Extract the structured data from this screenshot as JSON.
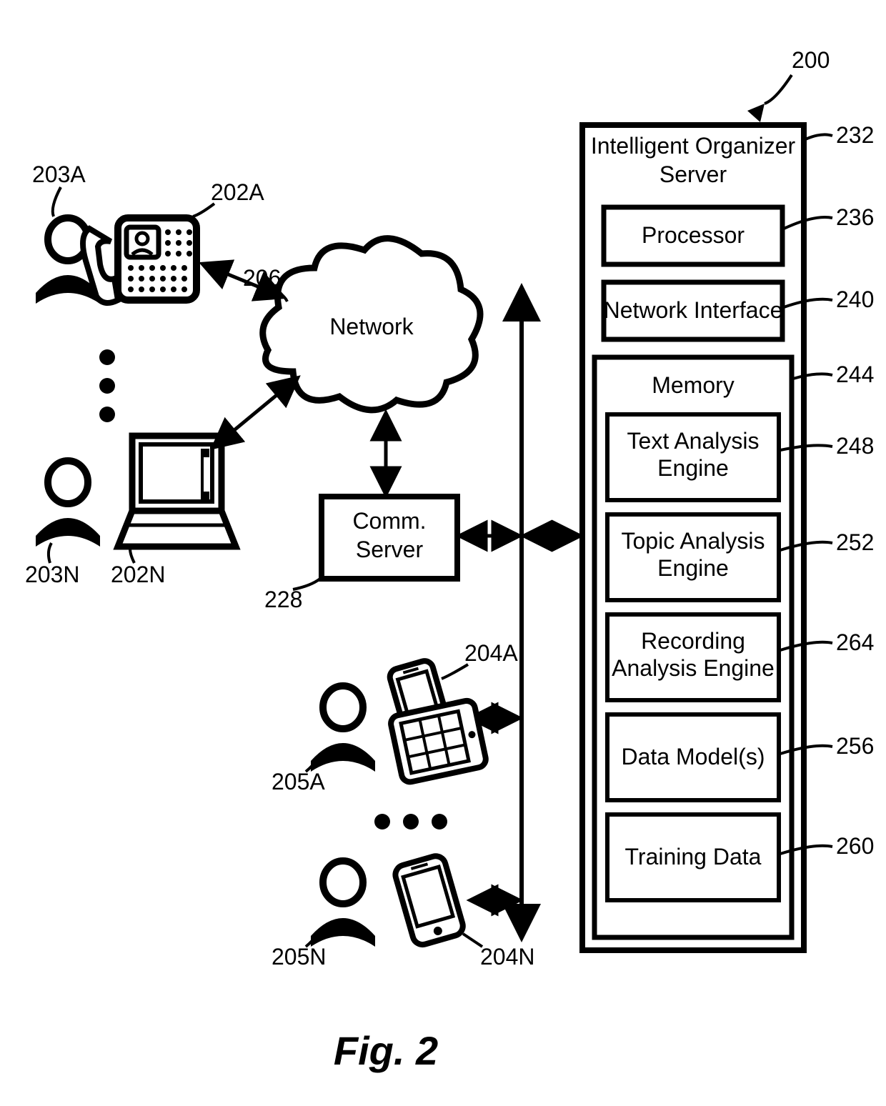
{
  "figure": {
    "caption": "Fig. 2",
    "system_label": "200"
  },
  "network": {
    "label": "Network",
    "ref": "206"
  },
  "comm_server": {
    "line1": "Comm.",
    "line2": "Server",
    "ref": "228"
  },
  "left_users": {
    "user_a": "203A",
    "device_a": "202A",
    "user_n": "203N",
    "device_n": "202N"
  },
  "right_users": {
    "user_a": "205A",
    "device_a": "204A",
    "user_n": "205N",
    "device_n": "204N"
  },
  "server": {
    "title1": "Intelligent Organizer",
    "title2": "Server",
    "ref": "232",
    "processor": {
      "label": "Processor",
      "ref": "236"
    },
    "network_if": {
      "label": "Network Interface",
      "ref": "240"
    },
    "memory": {
      "label": "Memory",
      "ref": "244",
      "text_engine": {
        "label": "Text Analysis Engine",
        "ref": "248"
      },
      "topic_engine": {
        "label": "Topic Analysis Engine",
        "ref": "252"
      },
      "rec_engine": {
        "label": "Recording Analysis Engine",
        "ref": "264"
      },
      "data_models": {
        "label": "Data Model(s)",
        "ref": "256"
      },
      "training": {
        "label": "Training Data",
        "ref": "260"
      }
    }
  }
}
